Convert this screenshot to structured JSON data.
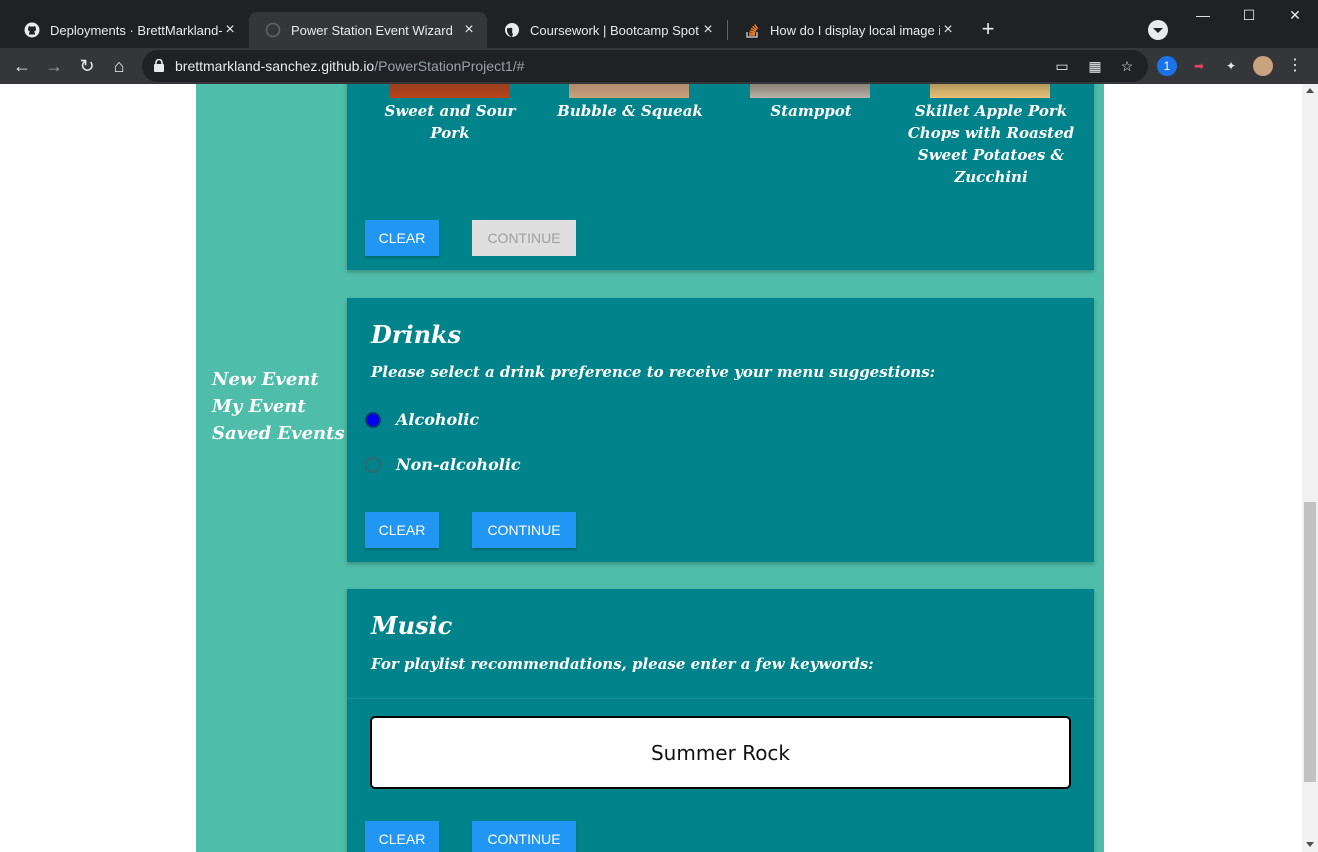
{
  "browser": {
    "tabs": [
      {
        "title": "Deployments · BrettMarkland-Sa",
        "icon": "github-icon"
      },
      {
        "title": "Power Station Event Wizard",
        "icon": "globe-icon"
      },
      {
        "title": "Coursework | Bootcamp Spot",
        "icon": "globe-icon"
      },
      {
        "title": "How do I display local image in r",
        "icon": "stackoverflow-icon"
      }
    ],
    "url_host": "brettmarkland-sanchez.github.io",
    "url_path": "/PowerStationProject1/#"
  },
  "sidenav": {
    "items": [
      "New Event",
      "My Event",
      "Saved Events"
    ]
  },
  "food": {
    "items": [
      "Sweet and Sour Pork",
      "Bubble & Squeak",
      "Stamppot",
      "Skillet Apple Pork Chops with Roasted Sweet Potatoes & Zucchini"
    ],
    "clear_label": "CLEAR",
    "continue_label": "CONTINUE"
  },
  "drinks": {
    "title": "Drinks",
    "subtitle": "Please select a drink preference to receive your menu suggestions:",
    "options": [
      "Alcoholic",
      "Non-alcoholic"
    ],
    "selected": "Alcoholic",
    "clear_label": "CLEAR",
    "continue_label": "CONTINUE"
  },
  "music": {
    "title": "Music",
    "subtitle": "For playlist recommendations, please enter a few keywords:",
    "keywords_value": "Summer Rock",
    "clear_label": "CLEAR",
    "continue_label": "CONTINUE"
  },
  "colors": {
    "page_bg": "#4ebda9",
    "card_bg": "#00838a",
    "button_primary": "#2196f3",
    "button_disabled": "#dfdfdf"
  }
}
